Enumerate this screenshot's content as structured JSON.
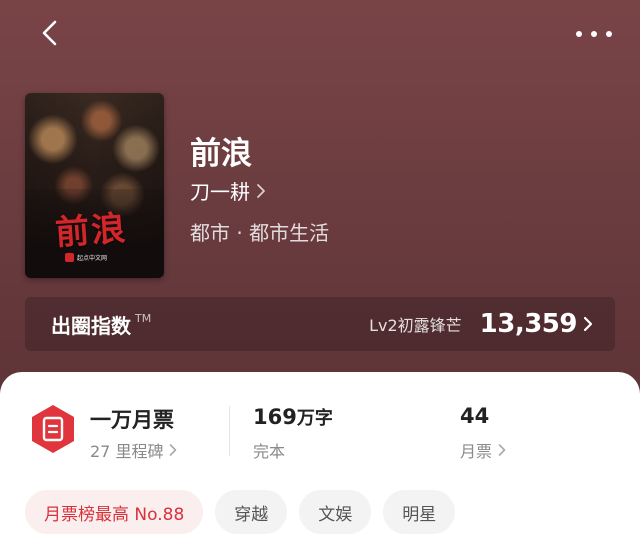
{
  "header": {
    "back_icon": "chevron-left-icon",
    "more_icon": "more-dots-icon"
  },
  "book": {
    "cover_title": "前浪",
    "cover_publisher": "起点中文网",
    "title": "前浪",
    "author": "刀一耕",
    "genre": "都市 · 都市生活"
  },
  "influence": {
    "label": "出圈指数",
    "tm": "TM",
    "level": "Lv2初露锋芒",
    "value": "13,359"
  },
  "stats": {
    "milestone_title": "一万月票",
    "milestone_sub": "27 里程碑",
    "words_number": "169",
    "words_unit": "万字",
    "status": "完本",
    "votes_number": "44",
    "votes_label": "月票"
  },
  "tags": [
    "月票榜最高 No.88",
    "穿越",
    "文娱",
    "明星"
  ],
  "colors": {
    "hero_bg": "#6c3d40",
    "accent": "#d8323a",
    "tag_bg": "#f3f3f3"
  }
}
